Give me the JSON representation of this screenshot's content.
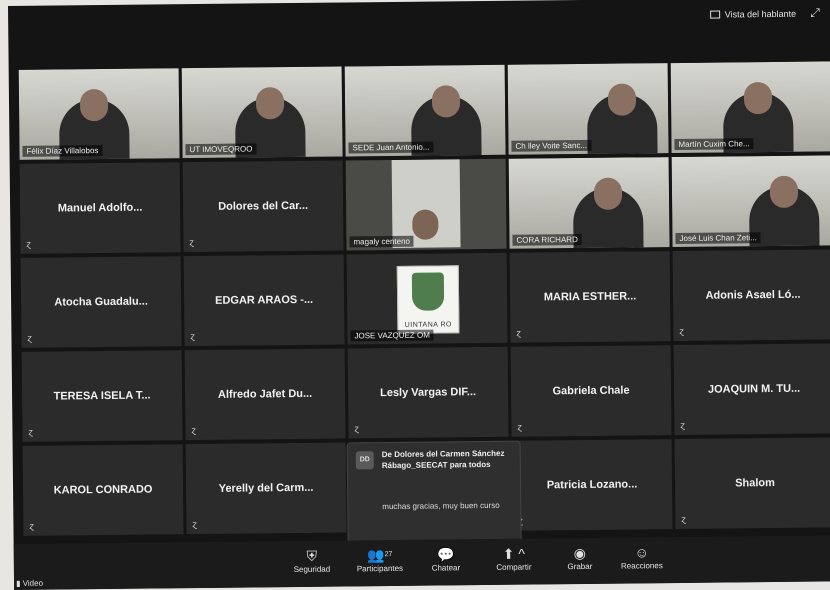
{
  "header": {
    "view_label": "Vista del hablante"
  },
  "tiles": [
    {
      "label": "Félix Díaz Villalobos",
      "kind": "video"
    },
    {
      "label": "UT IMOVEQROO",
      "kind": "video"
    },
    {
      "label": "SEDE Juan Antonio...",
      "kind": "video"
    },
    {
      "label": "Ch lley Voite Sanc...",
      "kind": "video"
    },
    {
      "label": "Martín Cuxim Che...",
      "kind": "video"
    },
    {
      "label": "Manuel Adolfo...",
      "kind": "name"
    },
    {
      "label": "Dolores del Car...",
      "kind": "name"
    },
    {
      "label": "magaly centeno",
      "kind": "video-inner"
    },
    {
      "label": "CORA RICHARD",
      "kind": "video"
    },
    {
      "label": "José Luis Chan Zeti...",
      "kind": "video"
    },
    {
      "label": "Atocha Guadalu...",
      "kind": "name"
    },
    {
      "label": "EDGAR ARAOS -...",
      "kind": "name"
    },
    {
      "label": "JOSE VAZQUEZ OM",
      "kind": "logo",
      "logo_text": "UINTANA RO"
    },
    {
      "label": "MARIA ESTHER...",
      "kind": "name"
    },
    {
      "label": "Adonis Asael Ló...",
      "kind": "name"
    },
    {
      "label": "TERESA ISELA T...",
      "kind": "name"
    },
    {
      "label": "Alfredo Jafet Du...",
      "kind": "name"
    },
    {
      "label": "Lesly Vargas DIF...",
      "kind": "name"
    },
    {
      "label": "Gabriela Chale",
      "kind": "name"
    },
    {
      "label": "JOAQUIN M. TU...",
      "kind": "name"
    },
    {
      "label": "KAROL CONRADO",
      "kind": "name"
    },
    {
      "label": "Yerelly del Carm...",
      "kind": "name"
    },
    {
      "label": "",
      "kind": "empty"
    },
    {
      "label": "Patricia Lozano...",
      "kind": "name"
    },
    {
      "label": "Shalom",
      "kind": "name"
    }
  ],
  "chat": {
    "initials": "DD",
    "from": "De Dolores del Carmen Sánchez Rábago_SEECAT para todos",
    "message": "muchas gracias, muy buen curso"
  },
  "toolbar": {
    "video": "Video",
    "security": "Seguridad",
    "participants": "Participantes",
    "participants_count": "27",
    "chat": "Chatear",
    "share": "Compartir",
    "record": "Grabar",
    "reactions": "Reacciones"
  },
  "icons": [
    "speaker-view-icon",
    "fullscreen-icon",
    "mic-muted-icon",
    "shield-icon",
    "participants-icon",
    "chat-icon",
    "share-icon",
    "record-icon",
    "reactions-icon",
    "video-icon"
  ]
}
